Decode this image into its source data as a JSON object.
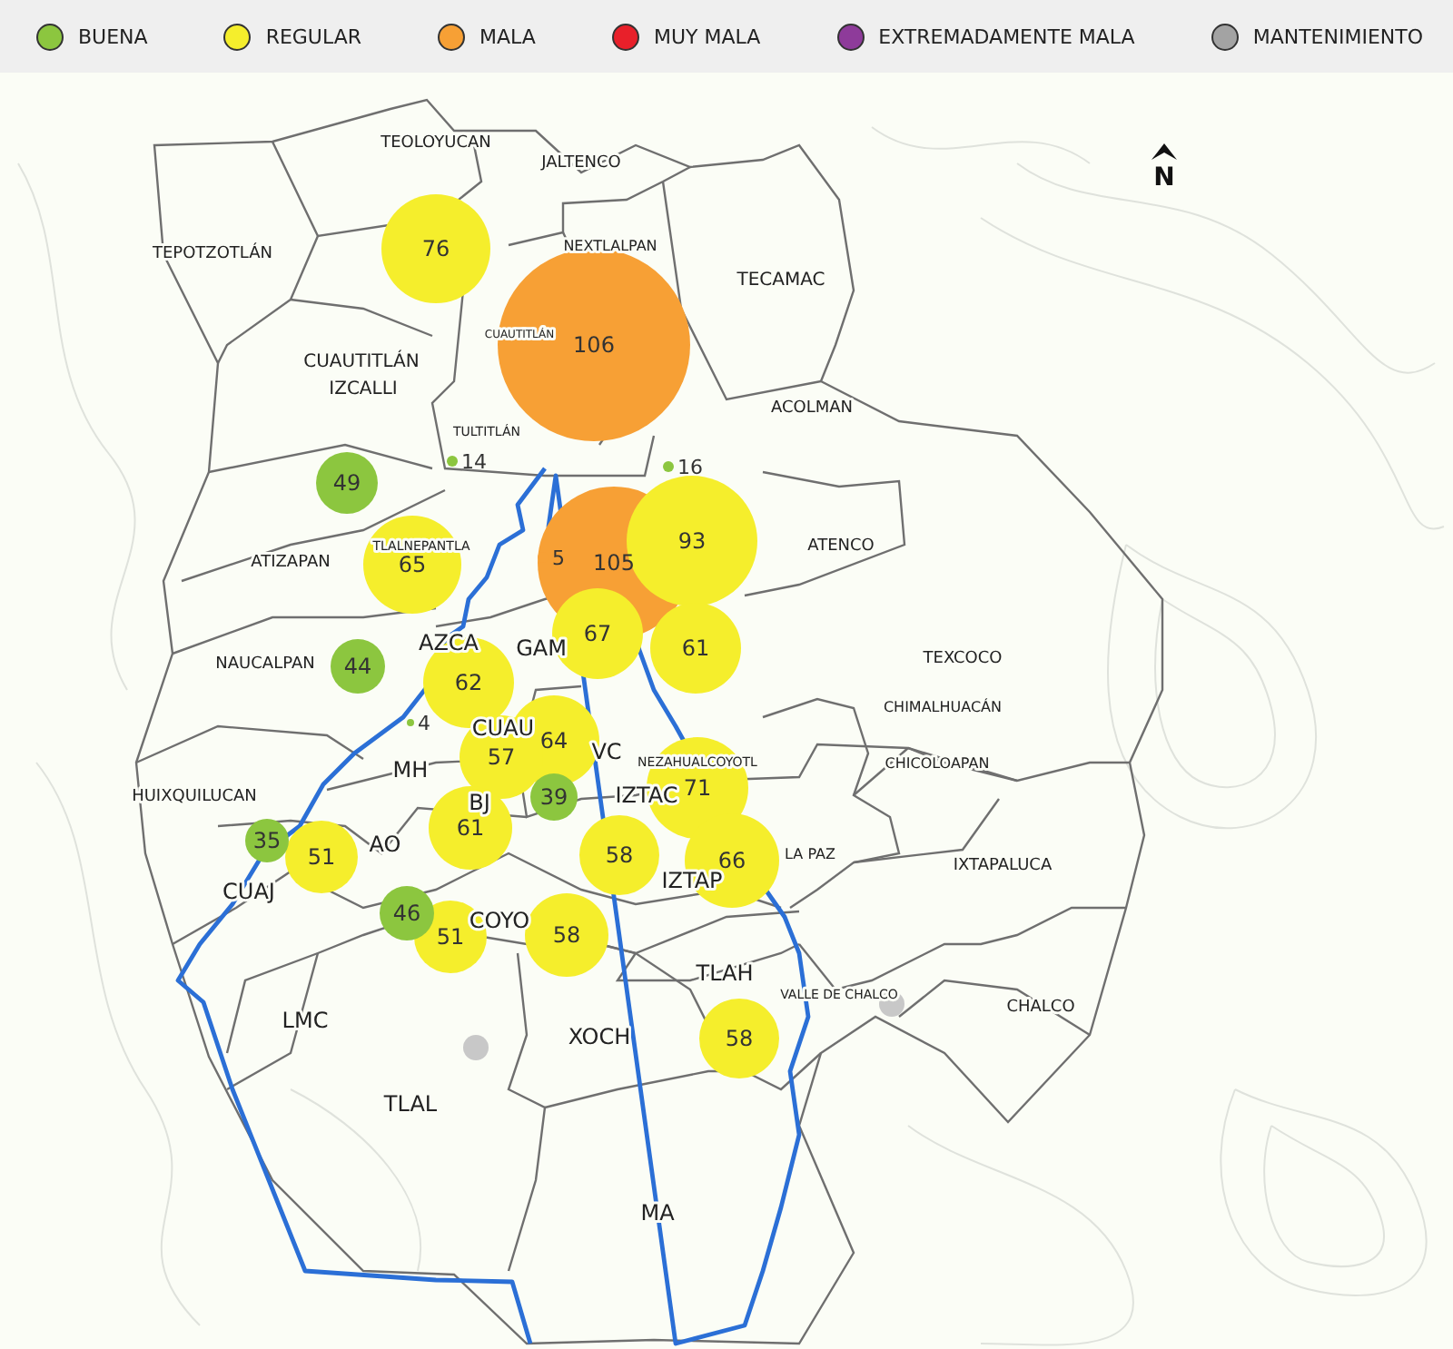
{
  "legend": [
    {
      "label": "BUENA",
      "color": "#8cc63f"
    },
    {
      "label": "REGULAR",
      "color": "#f5ee2c"
    },
    {
      "label": "MALA",
      "color": "#f7a035"
    },
    {
      "label": "MUY MALA",
      "color": "#e8202a"
    },
    {
      "label": "EXTREMADAMENTE MALA",
      "color": "#8e3b9a"
    },
    {
      "label": "MANTENIMIENTO",
      "color": "#a3a3a3"
    }
  ],
  "map": {
    "north_label": "N",
    "municipalities": [
      "TEOLOYUCAN",
      "JALTENCO",
      "TEPOTZOTLÁN",
      "NEXTLALPAN",
      "TECAMAC",
      "CUAUTITLÁN",
      "CUAUTITLÁN",
      "IZCALLI",
      "ACOLMAN",
      "TULTITLÁN",
      "ATIZAPAN",
      "TLALNEPANTLA",
      "ATENCO",
      "AZCA",
      "GAM",
      "NAUCALPAN",
      "TEXCOCO",
      "CHIMALHUACÁN",
      "CUAU",
      "VC",
      "NEZAHUALCOYOTL",
      "MH",
      "CHICOLOAPAN",
      "HUIXQUILUCAN",
      "IZTAC",
      "AO",
      "BJ",
      "LA PAZ",
      "IXTAPALUCA",
      "IZTAP",
      "CUAJ",
      "COYO",
      "TLAH",
      "VALLE DE CHALCO",
      "CHALCO",
      "LMC",
      "XOCH",
      "TLAL",
      "MA"
    ],
    "stations": [
      {
        "value": "76",
        "color": "#f5ee2c"
      },
      {
        "value": "106",
        "color": "#f7a035"
      },
      {
        "value": "49",
        "color": "#8cc63f"
      },
      {
        "value": "14",
        "color": "#8cc63f"
      },
      {
        "value": "16",
        "color": "#8cc63f"
      },
      {
        "value": "65",
        "color": "#f5ee2c"
      },
      {
        "value": "5",
        "color": "#f7a035"
      },
      {
        "value": "105",
        "color": "#f7a035"
      },
      {
        "value": "93",
        "color": "#f5ee2c"
      },
      {
        "value": "44",
        "color": "#8cc63f"
      },
      {
        "value": "62",
        "color": "#f5ee2c"
      },
      {
        "value": "67",
        "color": "#f5ee2c"
      },
      {
        "value": "61",
        "color": "#f5ee2c"
      },
      {
        "value": "4",
        "color": "#8cc63f"
      },
      {
        "value": "57",
        "color": "#f5ee2c"
      },
      {
        "value": "64",
        "color": "#f5ee2c"
      },
      {
        "value": "39",
        "color": "#8cc63f"
      },
      {
        "value": "71",
        "color": "#f5ee2c"
      },
      {
        "value": "35",
        "color": "#8cc63f"
      },
      {
        "value": "51",
        "color": "#f5ee2c"
      },
      {
        "value": "61",
        "color": "#f5ee2c"
      },
      {
        "value": "58",
        "color": "#f5ee2c"
      },
      {
        "value": "66",
        "color": "#f5ee2c"
      },
      {
        "value": "46",
        "color": "#8cc63f"
      },
      {
        "value": "51",
        "color": "#f5ee2c"
      },
      {
        "value": "58",
        "color": "#f5ee2c"
      },
      {
        "color": "#c8c8c8"
      },
      {
        "value": "58",
        "color": "#f5ee2c"
      },
      {
        "color": "#c8c8c8"
      }
    ]
  }
}
